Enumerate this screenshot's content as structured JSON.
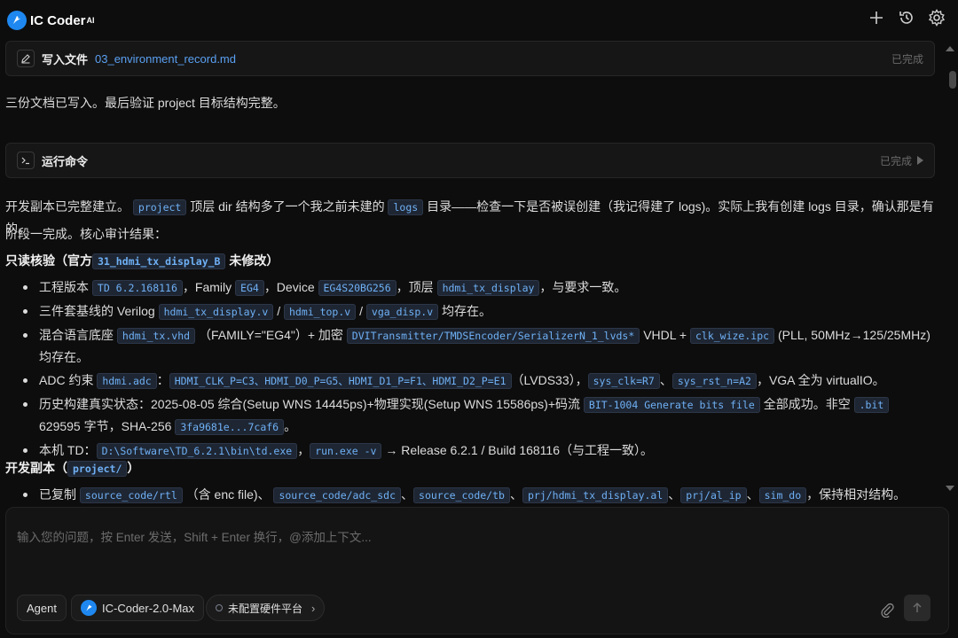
{
  "header": {
    "app_name": "IC Coder",
    "app_sup": "AI",
    "icons": [
      "plus-icon",
      "history-icon",
      "gear-icon"
    ]
  },
  "cards": {
    "write": {
      "label": "写入文件",
      "file": "03_environment_record.md",
      "status": "已完成"
    },
    "run": {
      "label": "运行命令",
      "status": "已完成"
    }
  },
  "messages": {
    "p1": "三份文档已写入。最后验证 project 目标结构完整。",
    "p2a": "开发副本已完整建立。",
    "p2_code1": "project",
    "p2b": "顶层 dir 结构多了一个我之前未建的",
    "p2_code2": "logs",
    "p2c": "目录——检查一下是否被误创建（我记得建了 logs)。实际上我有创建 logs 目录，确认那是有的。",
    "p3": "阶段一完成。核心审计结果：",
    "h1a": "只读核验（官方",
    "h1_code": "31_hdmi_tx_display_B",
    "h1b": "未修改）",
    "h2a": "开发副本（",
    "h2_code": "project/",
    "h2b": "）"
  },
  "list1": {
    "i1": {
      "t1": "工程版本",
      "c1": "TD 6.2.168116",
      "t2": "，Family",
      "c2": "EG4",
      "t3": "，Device",
      "c3": "EG4S20BG256",
      "t4": "，顶层",
      "c4": "hdmi_tx_display",
      "t5": "，与要求一致。"
    },
    "i2": {
      "t1": "三件套基线的 Verilog",
      "c1": "hdmi_tx_display.v",
      "s1": "/",
      "c2": "hdmi_top.v",
      "s2": "/",
      "c3": "vga_disp.v",
      "t2": "均存在。"
    },
    "i3": {
      "t1": "混合语言底座",
      "c1": "hdmi_tx.vhd",
      "t2": "（FAMILY=\"EG4\"）+ 加密",
      "c2": "DVITransmitter/TMDSEncoder/SerializerN_1_lvds*",
      "t3": "VHDL +",
      "c3": "clk_wize.ipc",
      "t4": "(PLL, 50MHz→125/25MHz) 均存在。"
    },
    "i4": {
      "t1": "ADC 约束",
      "c1": "hdmi.adc",
      "t2": "：",
      "c2": "HDMI_CLK_P=C3、HDMI_D0_P=G5、HDMI_D1_P=F1、HDMI_D2_P=E1",
      "t3": "（LVDS33），",
      "c3": "sys_clk=R7",
      "t4": "、",
      "c4": "sys_rst_n=A2",
      "t5": "，VGA 全为 virtualIO。"
    },
    "i5": {
      "t1": "历史构建真实状态：2025-08-05 综合(Setup WNS 14445ps)+物理实现(Setup WNS 15586ps)+码流",
      "c1": "BIT-1004 Generate bits file",
      "t2": "全部成功。非空",
      "c2": ".bit",
      "t3": "629595 字节，SHA-256",
      "c3": "3fa9681e...7caf6",
      "t4": "。"
    },
    "i6": {
      "t1": "本机 TD：",
      "c1": "D:\\Software\\TD_6.2.1\\bin\\td.exe",
      "t2": "，",
      "c2": "run.exe -v",
      "t3": "→ Release 6.2.1 / Build 168116（与工程一致）。"
    }
  },
  "list2": {
    "i1": {
      "t1": "已复制",
      "c1": "source_code/rtl",
      "t2": "（含 enc file)、",
      "c2": "source_code/adc_sdc",
      "t3": "、",
      "c3": "source_code/tb",
      "t4": "、",
      "c4": "prj/hdmi_tx_display.al",
      "t5": "、",
      "c5": "prj/al_ip",
      "t6": "、",
      "c6": "sim_do",
      "t7": "，保持相对结构。"
    }
  },
  "composer": {
    "placeholder": "输入您的问题，按 Enter 发送，Shift + Enter 换行，@添加上下文...",
    "mode": "Agent",
    "model": "IC-Coder-2.0-Max",
    "platform": "未配置硬件平台"
  },
  "colors": {
    "background": "#0d0d0d",
    "accent": "#1e88f0",
    "code": "#6fb0f5",
    "link": "#5aa0f2"
  }
}
